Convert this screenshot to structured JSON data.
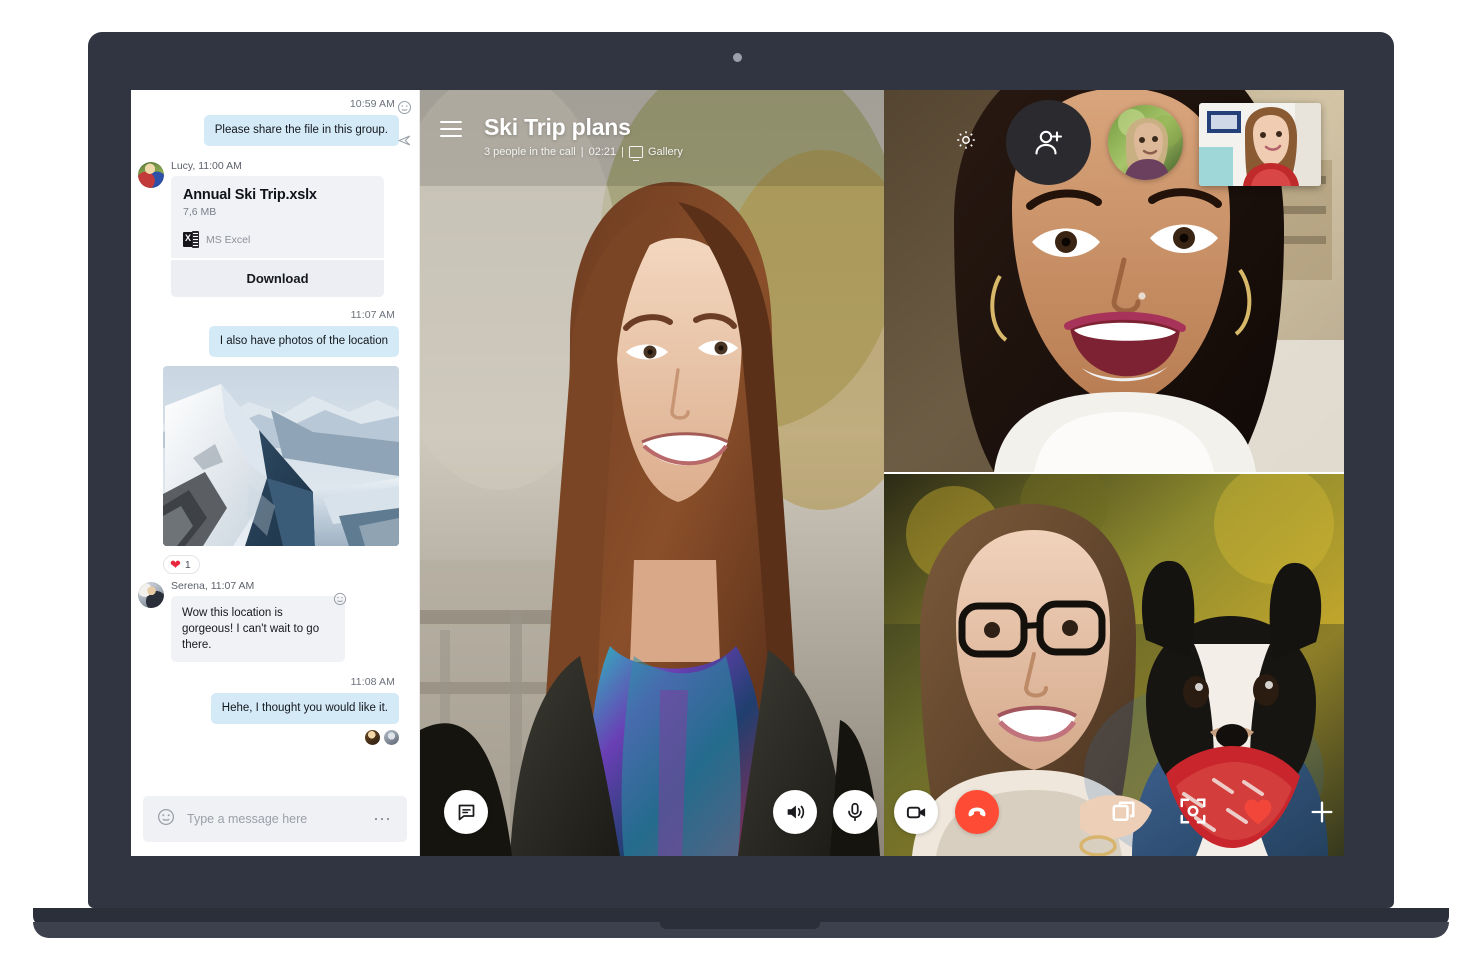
{
  "device": {
    "kind": "laptop",
    "bezel_color": "#303541",
    "webcam": "webcam-dot"
  },
  "app": {
    "name": "Skype",
    "accent_blue": "#d4eaf7",
    "end_call_color": "#fd4b35",
    "heart_color": "#f2463a"
  },
  "chat": {
    "panel_label": "conversation",
    "messages": [
      {
        "id": "m1",
        "direction": "out",
        "timestamp": "10:59 AM",
        "text": "Please share the file in this group."
      },
      {
        "id": "m2",
        "direction": "in",
        "sender_line": "Lucy, 11:00 AM",
        "sender": "Lucy",
        "time": "11:00 AM",
        "file": {
          "name": "Annual Ski Trip.xslx",
          "size": "7,6 MB",
          "app_label": "MS Excel",
          "app_icon": "excel-icon",
          "download_label": "Download"
        },
        "side_icons": [
          "emoji-icon",
          "forward-icon"
        ]
      },
      {
        "id": "m3",
        "direction": "out",
        "timestamp": "11:07 AM",
        "text": "I also have photos of the location",
        "attachment": {
          "kind": "photo",
          "alt": "snow-covered mountain ridge"
        },
        "reaction": {
          "emoji": "heart-icon",
          "count": "1"
        }
      },
      {
        "id": "m4",
        "direction": "in",
        "sender_line": "Serena, 11:07 AM",
        "sender": "Serena",
        "time": "11:07 AM",
        "text": "Wow this location is gorgeous! I can't wait to go there.",
        "side_icons": [
          "emoji-icon"
        ]
      },
      {
        "id": "m5",
        "direction": "out",
        "timestamp": "11:08 AM",
        "text": "Hehe, I thought you would like it.",
        "read_by": [
          "reader-1",
          "reader-2"
        ]
      }
    ],
    "composer": {
      "emoji_icon": "emoji-icon",
      "placeholder": "Type a message here",
      "more_icon": "more-options-icon"
    }
  },
  "call": {
    "menu_icon": "hamburger-menu-icon",
    "title": "Ski Trip plans",
    "participants_text": "3 people in the call",
    "separator1": "|",
    "duration": "02:21",
    "separator2": "|",
    "view_icon": "screen-icon",
    "view_mode": "Gallery",
    "top_controls": [
      {
        "name": "settings-button",
        "icon": "gear-icon"
      },
      {
        "name": "add-person-button",
        "icon": "add-person-icon"
      }
    ],
    "self_views": [
      {
        "name": "participant-thumbnail-circle",
        "shape": "circle"
      },
      {
        "name": "self-view-thumbnail",
        "shape": "rectangle"
      }
    ],
    "bottom_controls": [
      {
        "name": "chat-toggle-button",
        "icon": "chat-bubble-icon",
        "style": "white"
      },
      {
        "name": "speaker-button",
        "icon": "speaker-icon",
        "style": "white"
      },
      {
        "name": "microphone-button",
        "icon": "microphone-icon",
        "style": "white"
      },
      {
        "name": "camera-button",
        "icon": "video-camera-icon",
        "style": "white"
      },
      {
        "name": "end-call-button",
        "icon": "hang-up-icon",
        "style": "red"
      },
      {
        "name": "share-screen-button",
        "icon": "share-screen-icon",
        "style": "plain"
      },
      {
        "name": "snapshot-button",
        "icon": "snapshot-icon",
        "style": "plain"
      },
      {
        "name": "react-heart-button",
        "icon": "heart-icon",
        "style": "plain-red"
      },
      {
        "name": "add-reaction-button",
        "icon": "plus-icon",
        "style": "plain"
      }
    ],
    "tiles": [
      {
        "name": "main-video-tile",
        "alt": "woman with long brown hair and colorful scarf smiling outdoors"
      },
      {
        "name": "video-tile-top-right",
        "alt": "woman laughing close to camera indoors"
      },
      {
        "name": "video-tile-bottom-right",
        "alt": "woman with glasses holding a dog with red bandana"
      }
    ]
  }
}
